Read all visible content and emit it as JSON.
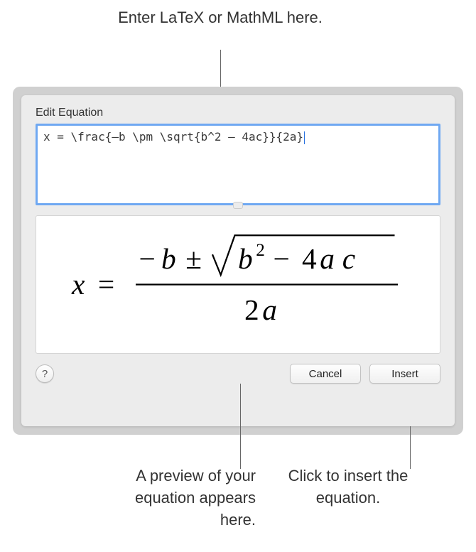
{
  "callouts": {
    "top": "Enter LaTeX or MathML here.",
    "bottomLeft": "A preview of your equation appears here.",
    "bottomRight": "Click to insert the equation."
  },
  "dialog": {
    "title": "Edit Equation",
    "inputValue": "x = \\frac{–b \\pm \\sqrt{b^2 – 4ac}}{2a}",
    "previewAlt": "x = (−b ± √(b² − 4ac)) / 2a",
    "helpLabel": "?",
    "cancelLabel": "Cancel",
    "insertLabel": "Insert"
  }
}
